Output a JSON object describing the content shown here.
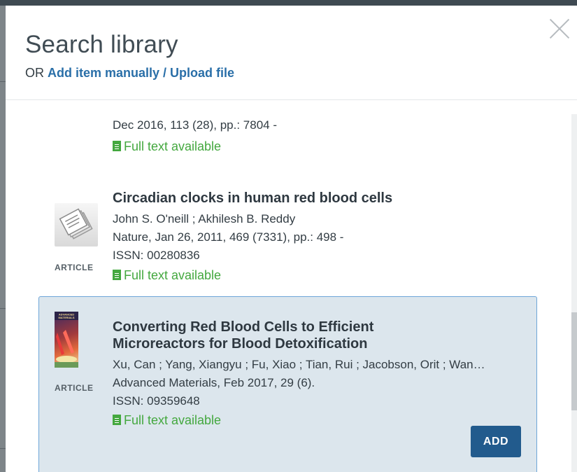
{
  "dialog": {
    "title": "Search library",
    "subtitle_prefix": "OR",
    "subtitle_link": "Add item manually / Upload file"
  },
  "results": [
    {
      "source_line": "Dec 2016,  113 (28),  pp.: 7804 -",
      "full_text": "Full text available"
    },
    {
      "title": "Circadian clocks in human red blood cells",
      "authors": "John S. O'neill ; Akhilesh B. Reddy",
      "source_line": "Nature,  Jan 26, 2011,  469 (7331),  pp.: 498 -",
      "issn": "ISSN: 00280836",
      "full_text": "Full text available",
      "type": "ARTICLE",
      "thumbnail": "generic-article-icon"
    },
    {
      "title_line1": "Converting Red Blood Cells to Efficient",
      "title_line2": "Microreactors for Blood Detoxification",
      "authors": "Xu, Can ; Yang, Xiangyu ; Fu, Xiao ; Tian, Rui ; Jacobson, Orit ; Wan…",
      "source_line": "Advanced Materials,  Feb 2017,  29 (6).",
      "issn": "ISSN: 09359648",
      "full_text": "Full text available",
      "type": "ARTICLE",
      "thumbnail": "advanced-materials-cover",
      "cover_text": "ADVANCED MATERIALS",
      "selected": true,
      "add_label": "ADD"
    }
  ],
  "colors": {
    "link": "#2a6fa8",
    "full_text": "#44a83f",
    "selected_bg": "#dce6ed",
    "selected_border": "#6ea6d8",
    "add_button": "#225b8d"
  }
}
